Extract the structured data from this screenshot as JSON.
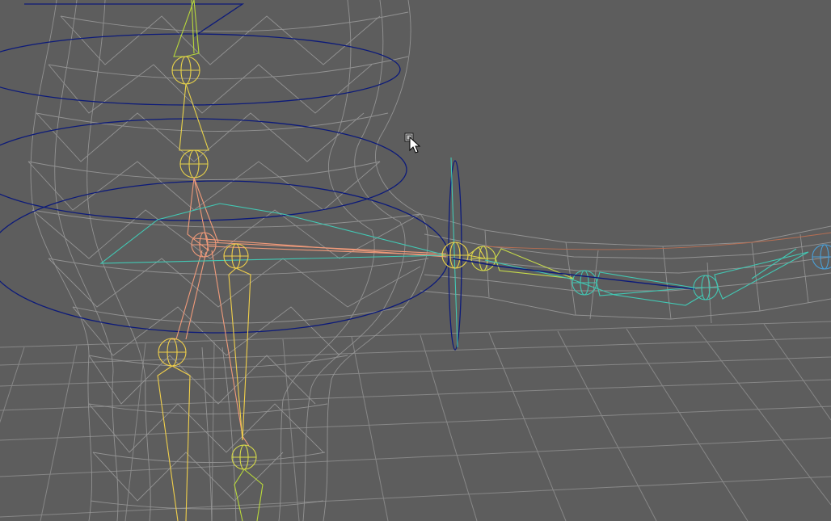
{
  "viewport": {
    "background": "#5d5d5d",
    "grid_color": "#878787",
    "mesh_color": "#9c9c9c",
    "control_color": "#0c1a7a",
    "joint_colors": {
      "spine": "#e8d24a",
      "spine_upper": "#b8d83a",
      "hip": "#f09a7a",
      "leg": "#f0cf4a",
      "arm": "#42c8b4",
      "hand": "#4aa0d8"
    },
    "cursor_icon": "arrow-cursor-with-move-box"
  }
}
